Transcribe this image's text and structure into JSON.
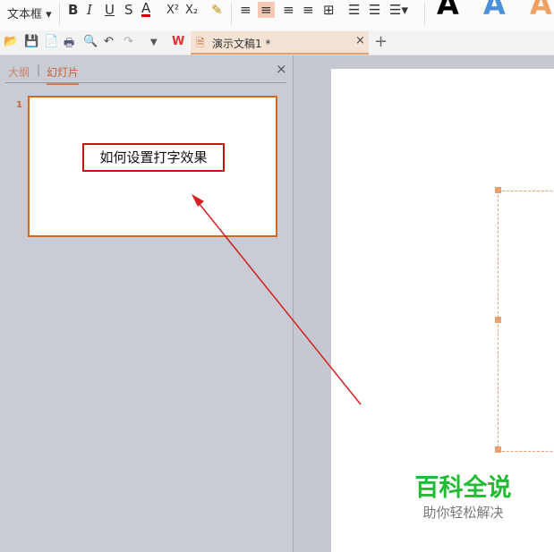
{
  "ribbon": {
    "textbox_label": "文本框",
    "bold": "B",
    "italic": "I",
    "underline": "U",
    "strike": "S",
    "font_color": "A",
    "superscript": "X²",
    "subscript": "X₂"
  },
  "tabs": [
    {
      "label": "演示文稿1 *"
    }
  ],
  "panel": {
    "tab_outline": "大纲",
    "tab_slides": "幻灯片",
    "slide_number": "1",
    "slide_title": "如何设置打字效果"
  },
  "watermark": {
    "title": "百科全说",
    "subtitle": "助你轻松解决"
  },
  "colors": {
    "accent": "#d2691e",
    "annotation": "#cc0000",
    "watermark": "#22bb33"
  }
}
